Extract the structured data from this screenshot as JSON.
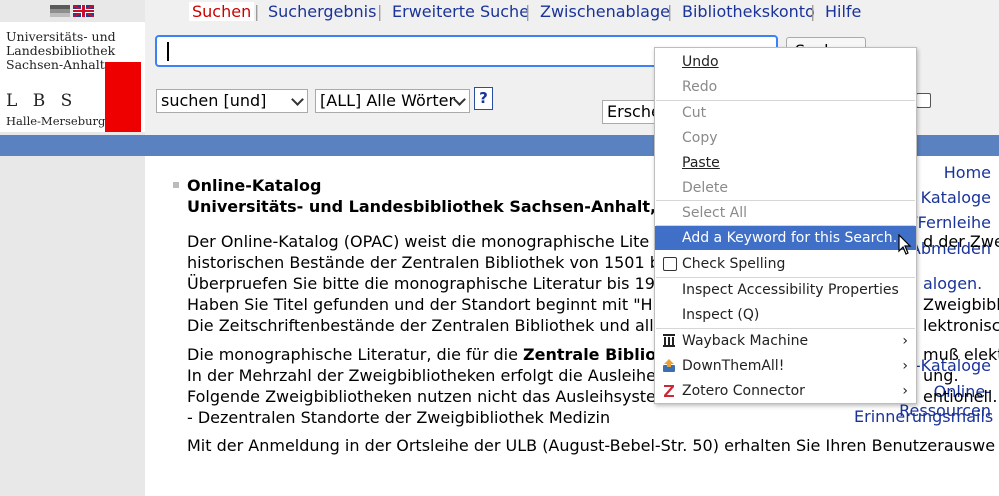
{
  "topnav": {
    "items": [
      {
        "label": "Suchen",
        "active": true
      },
      {
        "label": "Suchergebnis"
      },
      {
        "label": "Erweiterte Suche"
      },
      {
        "label": "Zwischenablage"
      },
      {
        "label": "Bibliothekskonto"
      },
      {
        "label": "Hilfe"
      }
    ],
    "separator": "|"
  },
  "flags": {
    "de": "german-flag",
    "en": "uk-flag"
  },
  "logo": {
    "line1": "Universitäts- und",
    "line2": "Landesbibliothek",
    "line3": "Sachsen-Anhalt",
    "acronym": "L B S",
    "city": "Halle-Merseburg",
    "red_color": "#ee0000"
  },
  "sidebar": {
    "links": [
      "Home",
      "Weitere Kataloge",
      "GBV/Fernleihe",
      "Abmelden"
    ],
    "links2": [
      "Image-Kataloge",
      "Online-Ressourcen",
      "Erinnerungsmails"
    ]
  },
  "search": {
    "value": "",
    "button_label": "Suchen",
    "action_select": "suchen [und]",
    "field_select": "[ALL] Alle Wörter",
    "help_label": "?",
    "year_label": "Ersche"
  },
  "content": {
    "title1": "Online-Katalog",
    "title2": "Universitäts- und Landesbibliothek Sachsen-Anhalt,",
    "p1": [
      "Der Online-Katalog (OPAC) weist die monographische Lite",
      "historischen Bestände der Zentralen Bibliothek von 1501 b",
      "Überpruefen Sie bitte die monographische Literatur bis 19",
      "Haben Sie Titel gefunden und der Standort beginnt mit \"H",
      "Die Zeitschriftenbestände der Zentralen Bibliothek und all"
    ],
    "p1_right": [
      "d der Zwe",
      "",
      "alogen.",
      "Zweigbibli",
      "lektronisch"
    ],
    "p2_prefix": "Die monographische Literatur, die für die ",
    "p2_bold": "Zentrale Bibliot",
    "p2_right": "muß elekt",
    "p2_lines": [
      "In der Mehrzahl der Zweigbibliotheken erfolgt die Ausleihe",
      "Folgende Zweigbibliotheken nutzen nicht das Ausleihsyste",
      "- Dezentralen Standorte der Zweigbibliothek Medizin"
    ],
    "p2_lines_right": [
      "ung.",
      "entionell.",
      ""
    ],
    "p3": "Mit der Anmeldung in der Ortsleihe der ULB (August-Bebel-Str. 50) erhalten Sie Ihren Benutzerauswe"
  },
  "context_menu": {
    "undo": "Undo",
    "redo": "Redo",
    "cut": "Cut",
    "copy": "Copy",
    "paste": "Paste",
    "delete": "Delete",
    "select_all": "Select All",
    "add_keyword": "Add a Keyword for this Search…",
    "check_spelling": "Check Spelling",
    "inspect_accessibility": "Inspect Accessibility Properties",
    "inspect": "Inspect (Q)",
    "wayback": "Wayback Machine",
    "downthemall": "DownThemAll!",
    "zotero": "Zotero Connector",
    "submenu_arrow": "›",
    "highlight_color": "#3f6fc7"
  },
  "colors": {
    "link": "#1a3399",
    "active_nav": "#cc0000",
    "blue_bar": "#5b82c0",
    "panel_bg": "#f0f0f0",
    "sidebar_bg": "#e8e8e8"
  }
}
